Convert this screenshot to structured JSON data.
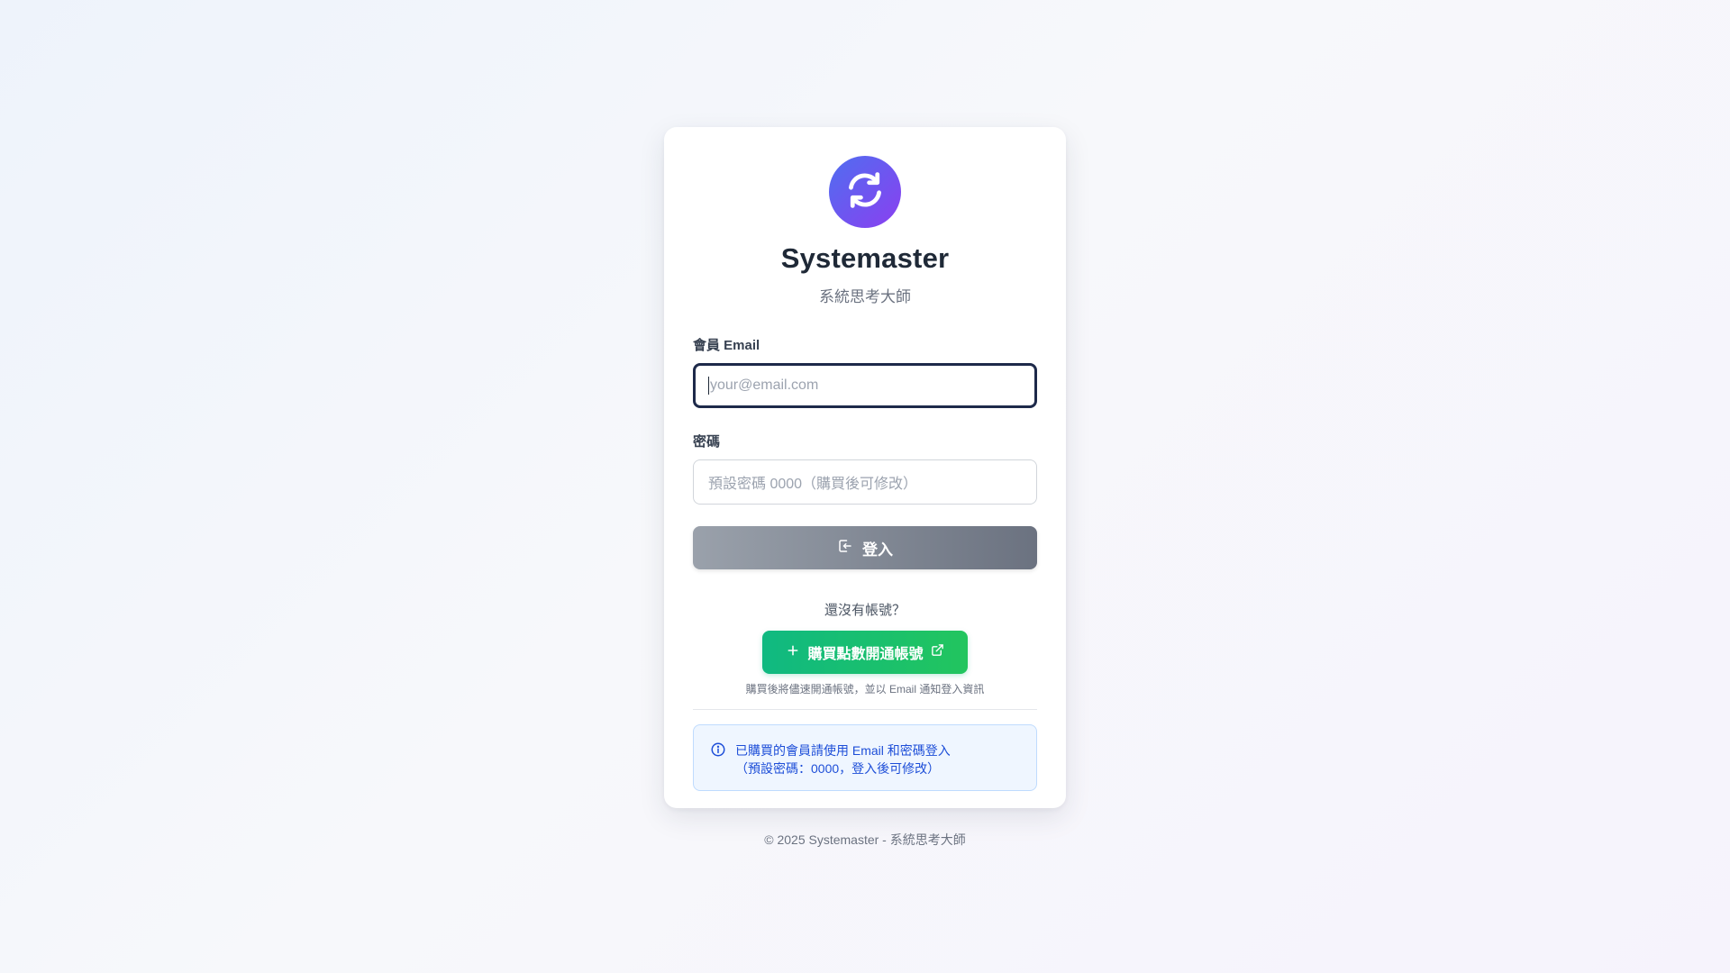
{
  "brand": {
    "title": "Systemaster",
    "subtitle": "系統思考大師",
    "logo_icon": "refresh-icon",
    "accent_gradient": [
      "#4f6ef0",
      "#8b3ff0"
    ]
  },
  "form": {
    "email_label": "會員 Email",
    "email_placeholder": "your@email.com",
    "email_value": "",
    "password_label": "密碼",
    "password_placeholder": "預設密碼 0000（購買後可修改）",
    "password_value": "",
    "login_label": "登入",
    "login_icon": "login-icon",
    "login_button_color": "#6b7280"
  },
  "signup": {
    "prompt": "還沒有帳號？",
    "buy_label": "購買點數開通帳號",
    "buy_icon_left": "plus-icon",
    "buy_icon_right": "external-link-icon",
    "buy_button_color": "#10b981",
    "note": "購買後將儘速開通帳號，並以 Email 通知登入資訊"
  },
  "info": {
    "icon": "info-icon",
    "line1": "已購買的會員請使用 Email 和密碼登入",
    "line2": "（預設密碼：0000，登入後可修改）",
    "color": "#1d4ed8"
  },
  "footer": {
    "text": "© 2025 Systemaster - 系統思考大師"
  }
}
